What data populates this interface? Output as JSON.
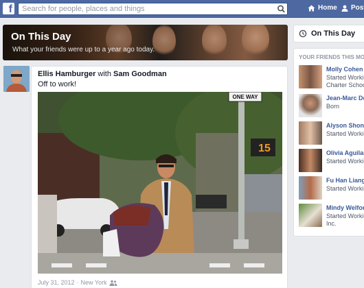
{
  "app": {
    "logo_letter": "f"
  },
  "topbar": {
    "search_placeholder": "Search for people, places and things",
    "nav": [
      {
        "label": "Home",
        "icon": "home-icon"
      },
      {
        "label": "Post",
        "icon": "post-icon"
      }
    ]
  },
  "banner": {
    "title": "On This Day",
    "subtitle": "What your friends were up to a year ago today."
  },
  "post": {
    "author": "Ellis Hamburger",
    "with_word": "with",
    "tagged": "Sam Goodman",
    "text": "Off to work!",
    "meta_date": "July 31, 2012",
    "meta_sep": "·",
    "meta_place": "New York",
    "photo_signs": {
      "one_way": "ONE WAY",
      "countdown": "15"
    }
  },
  "sidebar": {
    "tab_label": "On This Day",
    "friends_heading": "YOUR FRIENDS THIS MON",
    "friends": [
      {
        "name": "Molly Cohen",
        "line1": "Started Workin",
        "line2": "Charter School"
      },
      {
        "name": "Jean-Marc De",
        "line1": "Born",
        "line2": ""
      },
      {
        "name": "Alyson Shonte",
        "line1": "Started Workin",
        "line2": ""
      },
      {
        "name": "Olivia Aguilar",
        "line1": "Started Workin",
        "line2": ""
      },
      {
        "name": "Fu Han Liang",
        "line1": "Started Workin",
        "line2": ""
      },
      {
        "name": "Mindy Welford",
        "line1": "Started Workin",
        "line2": "Inc."
      }
    ]
  },
  "colors": {
    "brand": "#4e69a2",
    "link": "#3b5998",
    "background": "#e9ebee"
  }
}
